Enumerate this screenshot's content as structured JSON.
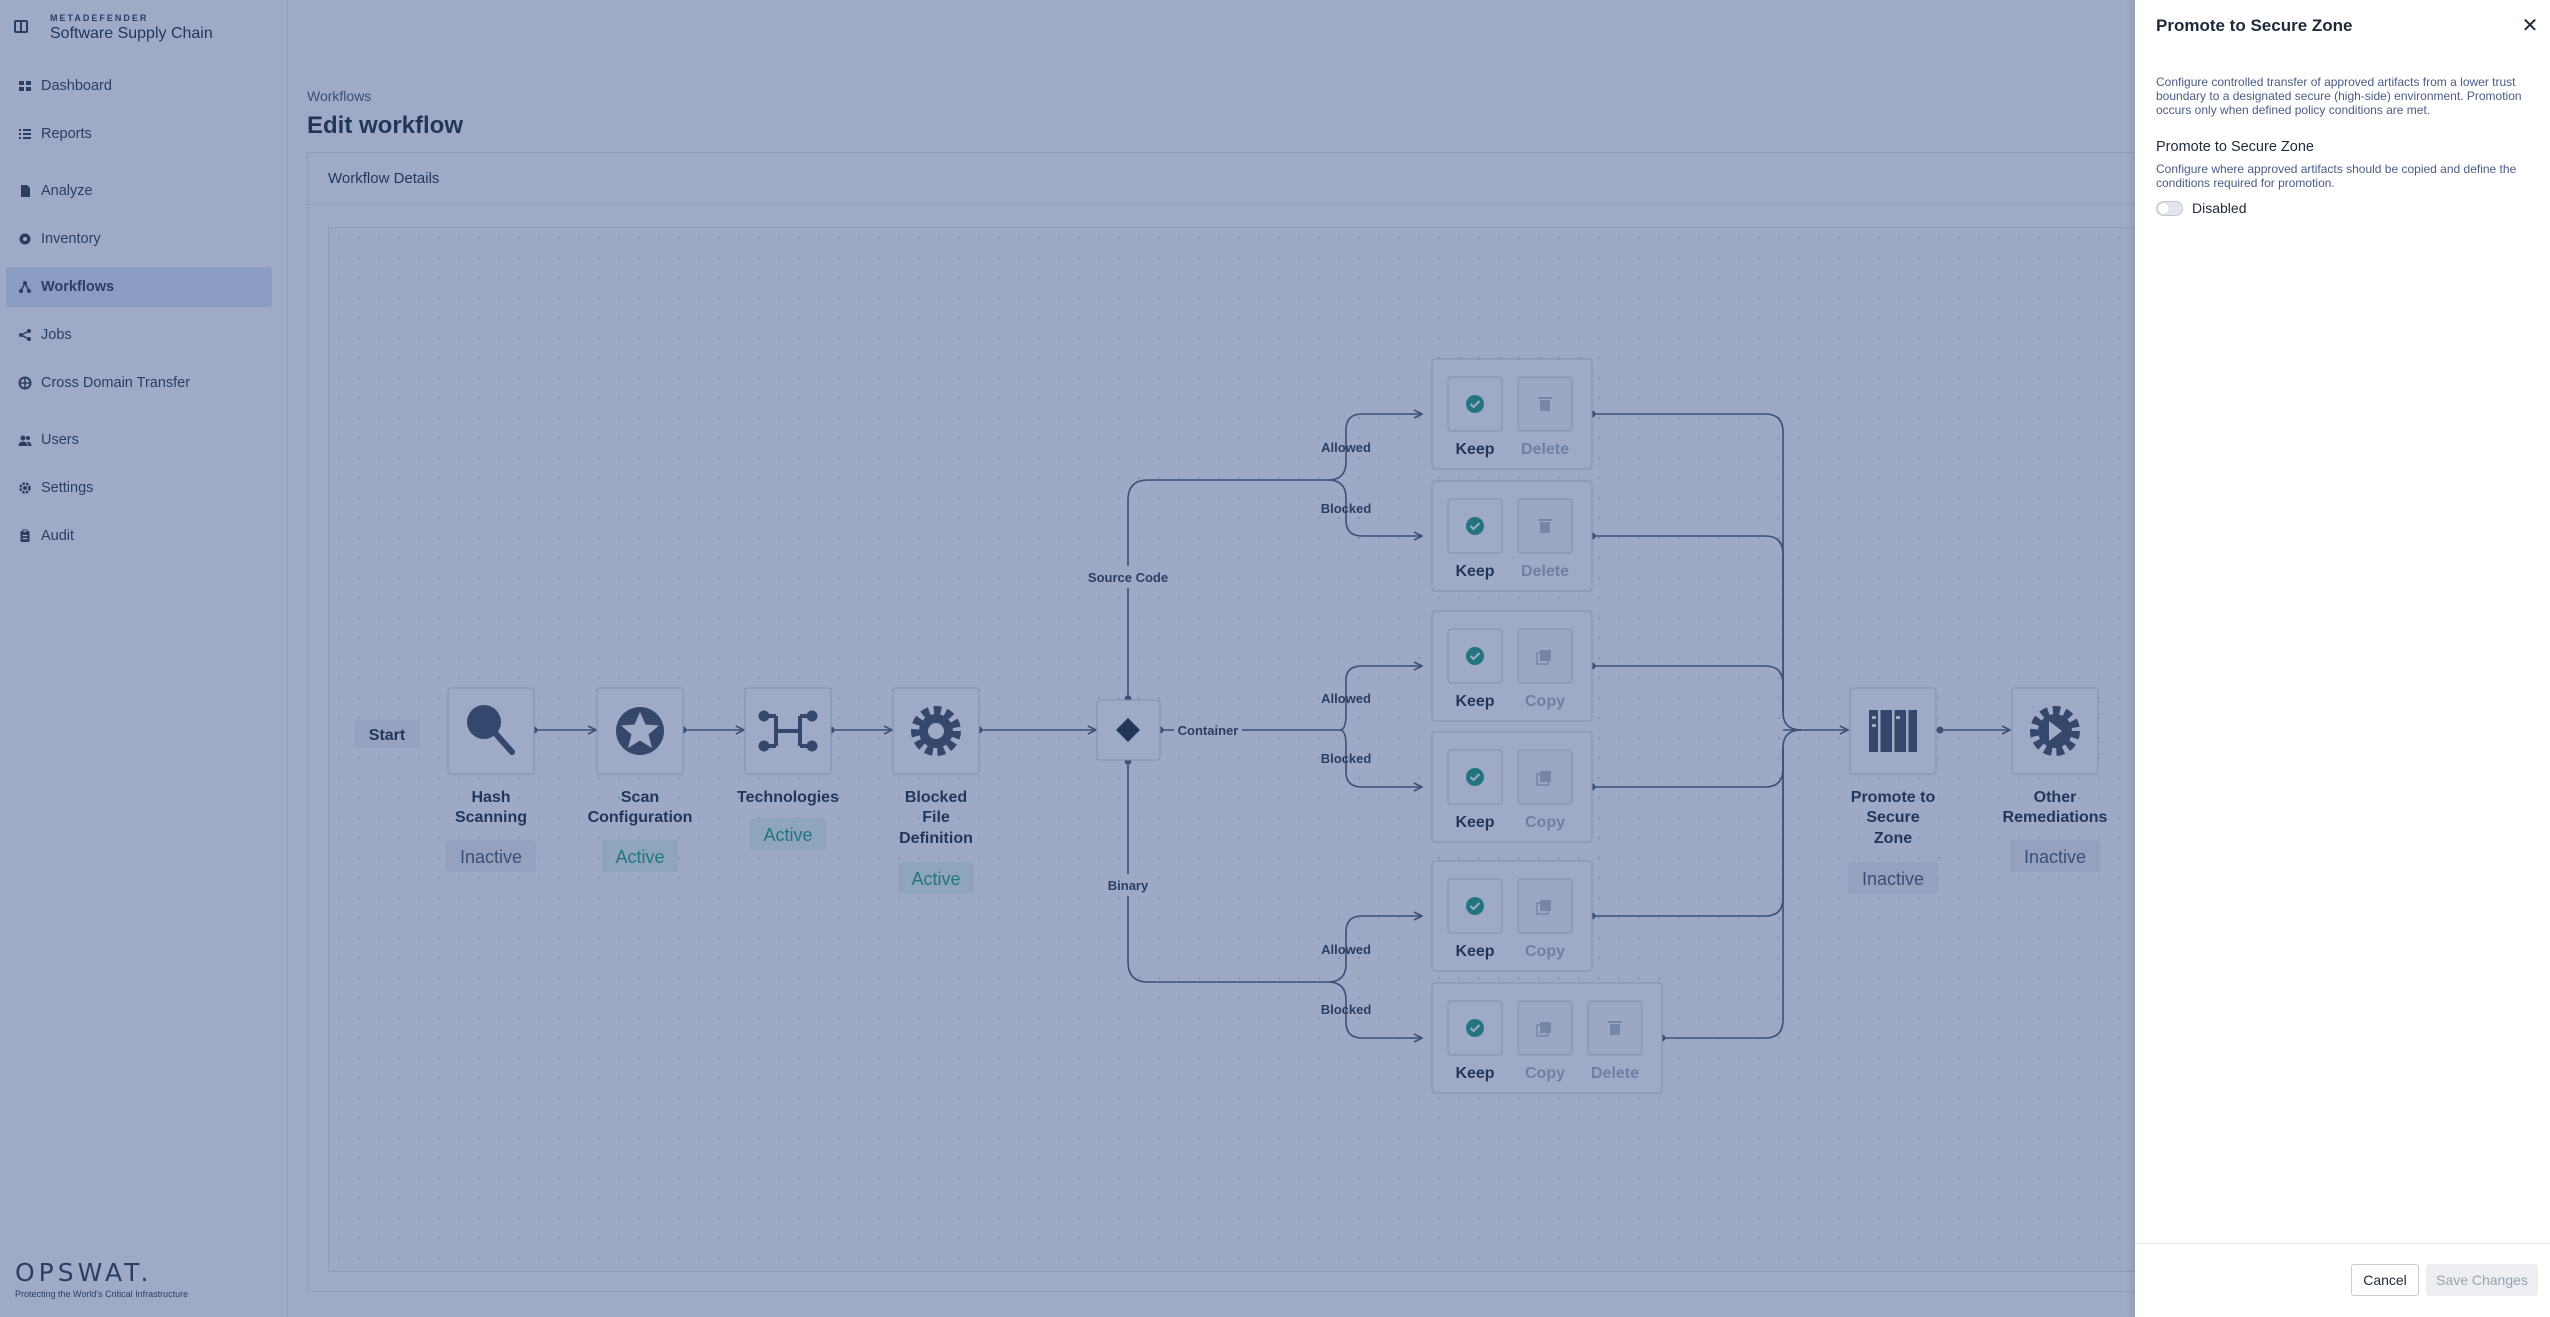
{
  "app": {
    "brand_small": "METADEFENDER",
    "brand_name": "Software Supply Chain",
    "footer_logo": "OPSWAT.",
    "footer_tagline": "Protecting the World's Critical Infrastructure"
  },
  "sidebar": {
    "items": [
      {
        "label": "Dashboard",
        "icon": "dashboard-icon"
      },
      {
        "label": "Reports",
        "icon": "list-icon"
      },
      {
        "label": "Analyze",
        "icon": "file-icon"
      },
      {
        "label": "Inventory",
        "icon": "globe-icon"
      },
      {
        "label": "Workflows",
        "icon": "workflow-icon",
        "active": true
      },
      {
        "label": "Jobs",
        "icon": "share-icon"
      },
      {
        "label": "Cross Domain Transfer",
        "icon": "transfer-icon"
      },
      {
        "label": "Users",
        "icon": "users-icon"
      },
      {
        "label": "Settings",
        "icon": "gear-icon"
      },
      {
        "label": "Audit",
        "icon": "clipboard-icon"
      }
    ]
  },
  "main": {
    "breadcrumb": "Workflows",
    "title": "Edit workflow",
    "card_title": "Workflow Details"
  },
  "workflow": {
    "start": "Start",
    "steps": [
      {
        "label": [
          "Hash",
          "Scanning"
        ],
        "status": "Inactive",
        "icon": "magnifier-icon"
      },
      {
        "label": [
          "Scan",
          "Configuration"
        ],
        "status": "Active",
        "icon": "badge-star-icon"
      },
      {
        "label": [
          "Technologies"
        ],
        "status": "Active",
        "icon": "circuit-icon"
      },
      {
        "label": [
          "Blocked",
          "File",
          "Definition"
        ],
        "status": "Active",
        "icon": "gear-icon"
      },
      {
        "label": [
          "Promote to",
          "Secure",
          "Zone"
        ],
        "status": "Inactive",
        "icon": "server-rack-icon"
      },
      {
        "label": [
          "Other",
          "Remediations"
        ],
        "status": "Inactive",
        "icon": "play-gear-icon"
      }
    ],
    "branches": [
      "Source Code",
      "Container",
      "Binary"
    ],
    "outcomes": [
      "Allowed",
      "Blocked"
    ],
    "actions": {
      "keep": "Keep",
      "delete": "Delete",
      "copy": "Copy"
    }
  },
  "drawer": {
    "title": "Promote to Secure Zone",
    "description": "Configure controlled transfer of approved artifacts from a lower trust boundary to a designated secure (high-side) environment. Promotion occurs only when defined policy conditions are met.",
    "section_title": "Promote to Secure Zone",
    "section_description": "Configure where approved artifacts should be copied and define the conditions required for promotion.",
    "toggle_label": "Disabled",
    "toggle_on": false,
    "cancel_label": "Cancel",
    "save_label": "Save Changes"
  },
  "colors": {
    "overlay": "#2a4480",
    "active_status": "#1e9d7a",
    "inactive_status": "#4a5668",
    "accent": "#dbe4f7"
  }
}
